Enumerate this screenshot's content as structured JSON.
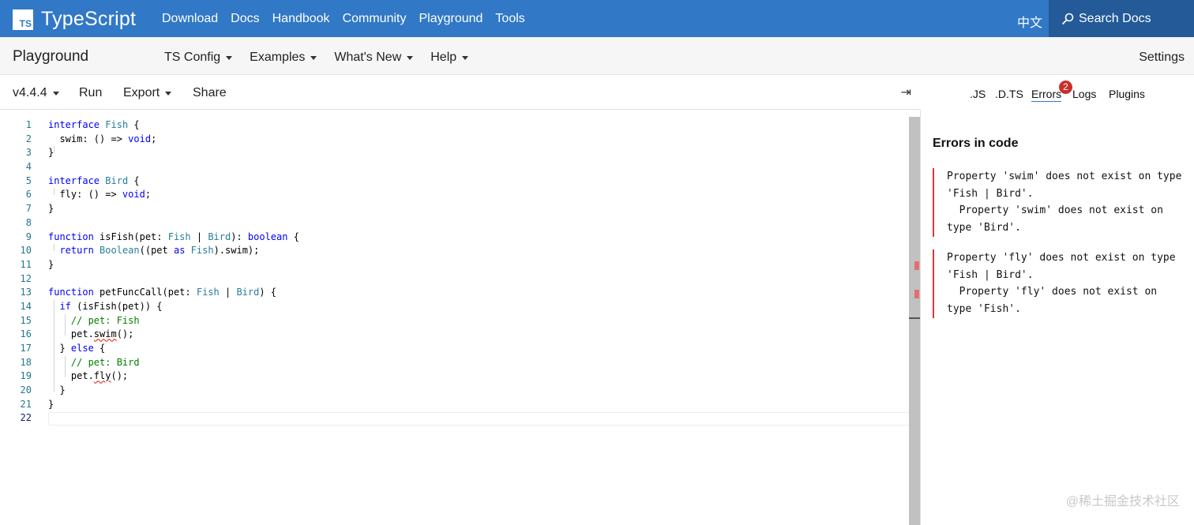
{
  "header": {
    "brand_logo": "TS",
    "brand_name": "TypeScript",
    "nav": [
      "Download",
      "Docs",
      "Handbook",
      "Community",
      "Playground",
      "Tools"
    ],
    "language": "中文",
    "search_label": "Search Docs"
  },
  "subnav": {
    "title": "Playground",
    "menus": [
      "TS Config",
      "Examples",
      "What's New",
      "Help"
    ],
    "settings": "Settings"
  },
  "toolbar": {
    "version": "v4.4.4",
    "run": "Run",
    "export": "Export",
    "share": "Share",
    "collapse_icon": "⇥"
  },
  "editor": {
    "line_numbers": [
      "1",
      "2",
      "3",
      "4",
      "5",
      "6",
      "7",
      "8",
      "9",
      "10",
      "11",
      "12",
      "13",
      "14",
      "15",
      "16",
      "17",
      "18",
      "19",
      "20",
      "21",
      "22"
    ],
    "current_line": 22
  },
  "panel": {
    "tabs": [
      ".JS",
      ".D.TS",
      "Errors",
      "Logs",
      "Plugins"
    ],
    "active_tab": "Errors",
    "error_count": "2",
    "errors_title": "Errors in code",
    "errors": [
      "Property 'swim' does not exist on type 'Fish | Bird'.\n  Property 'swim' does not exist on type 'Bird'.",
      "Property 'fly' does not exist on type 'Fish | Bird'.\n  Property 'fly' does not exist on type 'Fish'."
    ]
  },
  "watermark": "@稀土掘金技术社区",
  "colors": {
    "nav_bg": "#3178c6",
    "search_bg": "#235a97",
    "keyword": "#0000ff",
    "type": "#267f99",
    "comment": "#008000",
    "error": "#d7373f"
  }
}
